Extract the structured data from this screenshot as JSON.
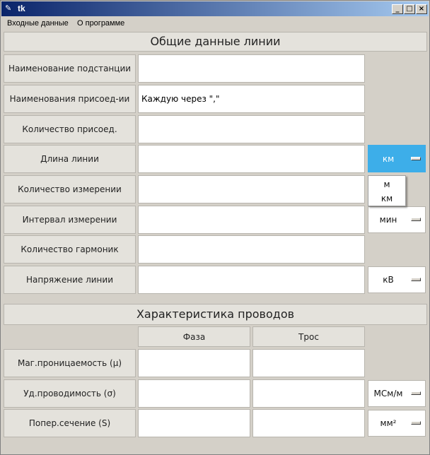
{
  "window": {
    "title": "tk"
  },
  "menubar": [
    "Входные данные",
    "О программе"
  ],
  "general": {
    "header": "Общие данные линии",
    "rows": [
      {
        "label": "Наименование подстанции",
        "value": ""
      },
      {
        "label": "Наименования присоед-ии",
        "value": "Каждую через \",\""
      },
      {
        "label": "Количество присоед.",
        "value": ""
      },
      {
        "label": "Длина линии",
        "value": "",
        "unit": "км"
      },
      {
        "label": "Количество измерении",
        "value": ""
      },
      {
        "label": "Интервал измерении",
        "value": "",
        "unit": "мин"
      },
      {
        "label": "Количество гармоник",
        "value": ""
      },
      {
        "label": "Напряжение линии",
        "value": "",
        "unit": "кВ"
      }
    ],
    "unit_dropdown": {
      "open_for": "Длина линии",
      "options": [
        "м",
        "км"
      ]
    }
  },
  "wires": {
    "header": "Характеристика проводов",
    "columns": [
      "Фаза",
      "Трос"
    ],
    "rows": [
      {
        "label": "Маг.проницаемость (μ)",
        "faza": "",
        "tros": ""
      },
      {
        "label": "Уд.проводимость (σ)",
        "faza": "",
        "tros": "",
        "unit": "МСм/м"
      },
      {
        "label": "Попер.сечение (S)",
        "faza": "",
        "tros": "",
        "unit": "мм²"
      }
    ]
  },
  "colors": {
    "active_unit": "#3daee9",
    "titlebar_start": "#0a246a",
    "titlebar_end": "#a6caf0"
  }
}
